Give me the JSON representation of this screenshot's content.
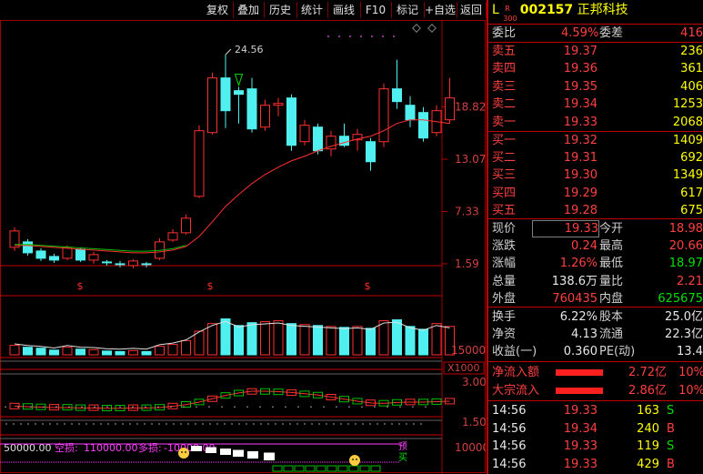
{
  "toolbar": {
    "buttons": [
      "复权",
      "叠加",
      "历史",
      "统计",
      "画线",
      "F10",
      "标记",
      "+自选",
      "返回"
    ]
  },
  "chart": {
    "price_axis": [
      "18.82",
      "13.07",
      "7.33",
      "1.59"
    ],
    "vol_axis": [
      "15000",
      "X1000"
    ],
    "ind_axis": [
      "3.00",
      "1.50"
    ],
    "bottom_axis": [
      "10000"
    ],
    "peak_label": "24.56",
    "bottom_info": {
      "v1": "50000.00",
      "label2": "空损:",
      "v2": "110000.00",
      "label3": "多损:",
      "v3": "-10000.00"
    },
    "s_marker": "$",
    "side_tags": [
      "预",
      "买"
    ],
    "colors": {
      "up": "#ff3030",
      "down": "#50f0f0",
      "ma": "#ff3030",
      "grid": "#800000"
    },
    "candles": [
      {
        "o": 3.4,
        "c": 5.2,
        "h": 5.6,
        "l": 3.0
      },
      {
        "o": 4.0,
        "c": 2.8,
        "h": 4.3,
        "l": 2.5
      },
      {
        "o": 3.0,
        "c": 2.2,
        "h": 3.3,
        "l": 1.9
      },
      {
        "o": 2.4,
        "c": 2.0,
        "h": 2.7,
        "l": 1.7
      },
      {
        "o": 2.2,
        "c": 3.4,
        "h": 3.6,
        "l": 2.0
      },
      {
        "o": 3.2,
        "c": 2.0,
        "h": 3.4,
        "l": 1.8
      },
      {
        "o": 2.0,
        "c": 2.6,
        "h": 2.9,
        "l": 1.6
      },
      {
        "o": 1.8,
        "c": 1.7,
        "h": 2.0,
        "l": 1.4
      },
      {
        "o": 1.6,
        "c": 1.5,
        "h": 1.9,
        "l": 1.2
      },
      {
        "o": 1.4,
        "c": 1.9,
        "h": 2.1,
        "l": 1.1
      },
      {
        "o": 1.6,
        "c": 1.5,
        "h": 1.8,
        "l": 1.2
      },
      {
        "o": 2.2,
        "c": 4.0,
        "h": 4.4,
        "l": 2.0
      },
      {
        "o": 4.2,
        "c": 5.0,
        "h": 5.4,
        "l": 4.0
      },
      {
        "o": 5.0,
        "c": 6.6,
        "h": 7.0,
        "l": 4.8
      },
      {
        "o": 9.0,
        "c": 16.2,
        "h": 16.8,
        "l": 8.8
      },
      {
        "o": 16.0,
        "c": 22.0,
        "h": 22.6,
        "l": 15.8
      },
      {
        "o": 22.0,
        "c": 18.4,
        "h": 24.56,
        "l": 16.5
      },
      {
        "o": 20.6,
        "c": 20.2,
        "h": 21.0,
        "l": 17.0
      },
      {
        "o": 20.8,
        "c": 16.4,
        "h": 22.0,
        "l": 16.0
      },
      {
        "o": 16.6,
        "c": 19.0,
        "h": 19.6,
        "l": 16.2
      },
      {
        "o": 19.0,
        "c": 19.2,
        "h": 19.8,
        "l": 17.8
      },
      {
        "o": 19.8,
        "c": 14.6,
        "h": 20.2,
        "l": 14.0
      },
      {
        "o": 15.0,
        "c": 16.8,
        "h": 17.4,
        "l": 14.6
      },
      {
        "o": 16.6,
        "c": 14.0,
        "h": 17.0,
        "l": 13.6
      },
      {
        "o": 14.2,
        "c": 15.6,
        "h": 16.2,
        "l": 13.4
      },
      {
        "o": 15.6,
        "c": 14.6,
        "h": 17.0,
        "l": 14.4
      },
      {
        "o": 15.2,
        "c": 15.8,
        "h": 16.4,
        "l": 14.0
      },
      {
        "o": 15.0,
        "c": 12.8,
        "h": 15.4,
        "l": 11.8
      },
      {
        "o": 15.0,
        "c": 20.8,
        "h": 21.4,
        "l": 14.4
      },
      {
        "o": 20.8,
        "c": 19.4,
        "h": 24.0,
        "l": 18.6
      },
      {
        "o": 19.0,
        "c": 17.4,
        "h": 20.0,
        "l": 16.6
      },
      {
        "o": 18.2,
        "c": 15.4,
        "h": 18.8,
        "l": 15.0
      },
      {
        "o": 16.0,
        "c": 18.4,
        "h": 19.0,
        "l": 15.6
      },
      {
        "o": 17.4,
        "c": 19.8,
        "h": 22.0,
        "l": 17.0
      }
    ],
    "ma": [
      3.6,
      3.6,
      3.5,
      3.4,
      3.3,
      3.2,
      3.1,
      3.0,
      2.9,
      2.8,
      2.8,
      2.9,
      3.1,
      3.5,
      4.6,
      6.2,
      7.9,
      9.2,
      10.4,
      11.4,
      12.2,
      12.9,
      13.4,
      14.0,
      14.5,
      14.9,
      15.3,
      15.6,
      16.2,
      17.0,
      17.4,
      17.4,
      17.2,
      17.0
    ],
    "vols": [
      2.0,
      1.6,
      1.4,
      1.0,
      1.6,
      1.2,
      1.1,
      0.8,
      0.7,
      0.9,
      0.7,
      1.8,
      2.2,
      3.0,
      5.0,
      6.6,
      7.6,
      6.2,
      6.8,
      7.0,
      7.2,
      6.6,
      6.4,
      6.2,
      6.0,
      5.8,
      6.0,
      5.6,
      7.2,
      7.4,
      6.0,
      5.4,
      6.6,
      6.0
    ],
    "ind": [
      0.7,
      0.65,
      0.6,
      0.55,
      0.55,
      0.5,
      0.5,
      0.45,
      0.45,
      0.5,
      0.5,
      0.55,
      0.7,
      0.9,
      1.2,
      1.6,
      2.0,
      2.3,
      2.5,
      2.5,
      2.45,
      2.35,
      2.2,
      2.05,
      1.8,
      1.55,
      1.3,
      1.1,
      1.05,
      1.15,
      1.2,
      1.2,
      1.25,
      1.3
    ]
  },
  "panel": {
    "header": {
      "market": "L",
      "sup": "R",
      "sub": "300",
      "code": "002157",
      "name": "正邦科技"
    },
    "wb": {
      "label": "委比",
      "value": "4.59%",
      "label2": "委差",
      "value2": "416"
    },
    "asks": [
      {
        "label": "卖五",
        "price": "19.37",
        "vol": "236"
      },
      {
        "label": "卖四",
        "price": "19.36",
        "vol": "361"
      },
      {
        "label": "卖三",
        "price": "19.35",
        "vol": "406"
      },
      {
        "label": "卖二",
        "price": "19.34",
        "vol": "1253"
      },
      {
        "label": "卖一",
        "price": "19.33",
        "vol": "2068"
      }
    ],
    "bids": [
      {
        "label": "买一",
        "price": "19.32",
        "vol": "1409"
      },
      {
        "label": "买二",
        "price": "19.31",
        "vol": "692"
      },
      {
        "label": "买三",
        "price": "19.30",
        "vol": "1349"
      },
      {
        "label": "买四",
        "price": "19.29",
        "vol": "617"
      },
      {
        "label": "买五",
        "price": "19.28",
        "vol": "675"
      }
    ],
    "quote": [
      {
        "l1": "现价",
        "v1": "19.33",
        "l2": "今开",
        "v2": "18.98",
        "c1": "red",
        "c2": "red"
      },
      {
        "l1": "涨跌",
        "v1": "0.24",
        "l2": "最高",
        "v2": "20.66",
        "c1": "red",
        "c2": "red"
      },
      {
        "l1": "涨幅",
        "v1": "1.26%",
        "l2": "最低",
        "v2": "18.97",
        "c1": "red",
        "c2": "grn"
      },
      {
        "l1": "总量",
        "v1": "138.6万",
        "l2": "量比",
        "v2": "2.21",
        "c1": "wht",
        "c2": "red"
      },
      {
        "l1": "外盘",
        "v1": "760435",
        "l2": "内盘",
        "v2": "625675",
        "c1": "red",
        "c2": "grn"
      }
    ],
    "fund": [
      {
        "l1": "换手",
        "v1": "6.22%",
        "l2": "股本",
        "v2": "25.0亿"
      },
      {
        "l1": "净资",
        "v1": "4.13",
        "l2": "流通",
        "v2": "22.3亿"
      },
      {
        "l1": "收益(一)",
        "v1": "0.360",
        "l2": "PE(动)",
        "v2": "13.4"
      }
    ],
    "flows": [
      {
        "label": "净流入额",
        "value": "2.72亿",
        "pct": "10%"
      },
      {
        "label": "大宗流入",
        "value": "2.86亿",
        "pct": "10%"
      }
    ],
    "ticks": [
      {
        "time": "14:56",
        "price": "19.33",
        "vol": "163",
        "side": "S"
      },
      {
        "time": "14:56",
        "price": "19.34",
        "vol": "240",
        "side": "B"
      },
      {
        "time": "14:56",
        "price": "19.33",
        "vol": "119",
        "side": "S"
      },
      {
        "time": "14:56",
        "price": "19.33",
        "vol": "429",
        "side": "B"
      }
    ]
  }
}
